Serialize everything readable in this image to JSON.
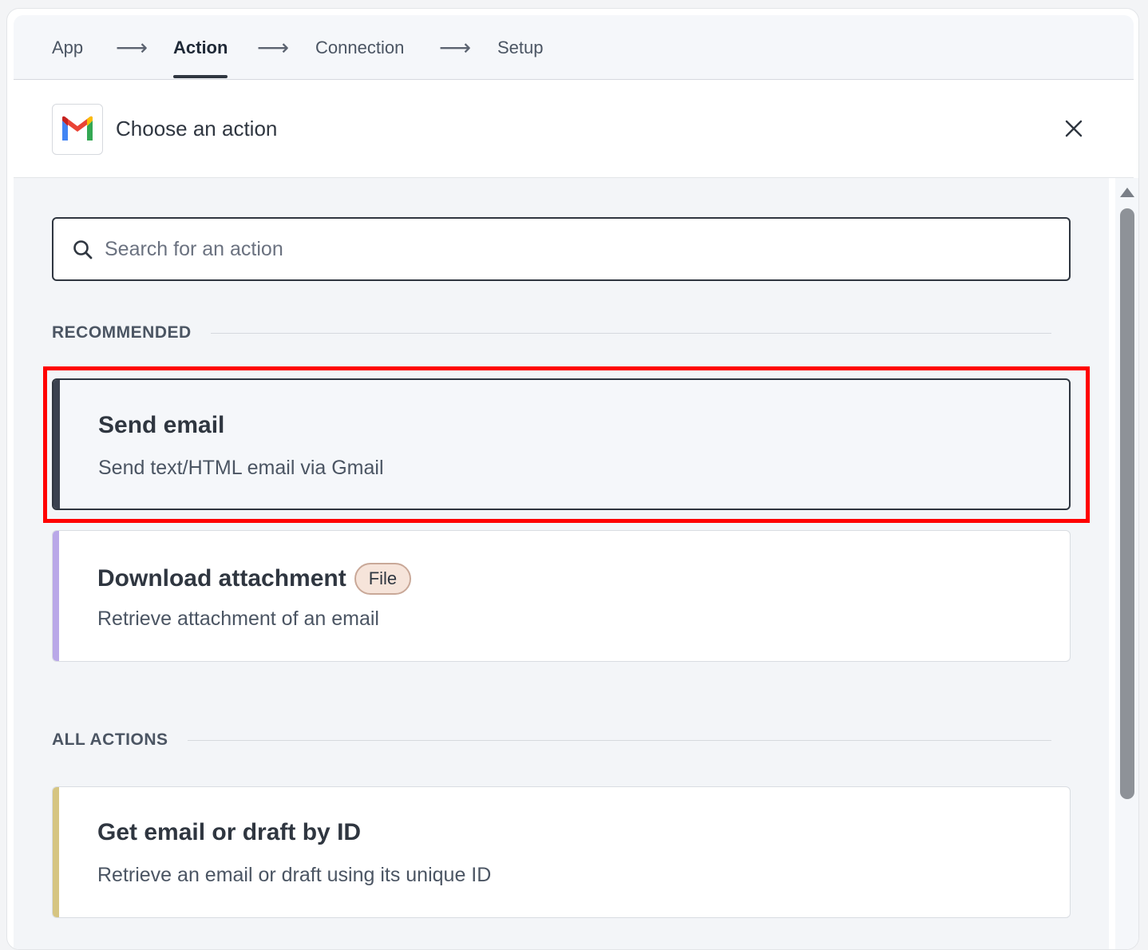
{
  "steps": [
    {
      "label": "App"
    },
    {
      "label": "Action"
    },
    {
      "label": "Connection"
    },
    {
      "label": "Setup"
    }
  ],
  "arrow": "⟶",
  "header": {
    "title": "Choose an action"
  },
  "search": {
    "placeholder": "Search for an action",
    "value": ""
  },
  "sections": {
    "recommended": "RECOMMENDED",
    "all_actions": "ALL ACTIONS"
  },
  "recommended": [
    {
      "name": "Send email",
      "desc": "Send text/HTML email via Gmail",
      "accent": "#3b4250"
    },
    {
      "name": "Download attachment",
      "badge": "File",
      "desc": "Retrieve attachment of an email",
      "accent": "#b9a8e8"
    }
  ],
  "all_actions": [
    {
      "name": "Get email or draft by ID",
      "desc": "Retrieve an email or draft using its unique ID",
      "accent": "#d6c582"
    }
  ],
  "icons": {
    "app": "gmail-logo-icon",
    "close": "close-icon",
    "search": "search-icon"
  }
}
